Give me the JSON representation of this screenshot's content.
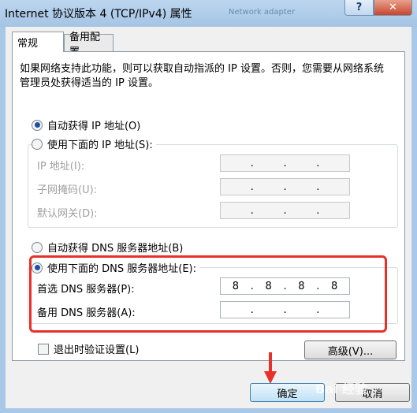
{
  "window": {
    "title": "Internet 协议版本 4 (TCP/IPv4) 属性",
    "background_title": "Network adapter",
    "help_label": "?",
    "close_label": "✕"
  },
  "tabs": [
    {
      "label": "常规",
      "active": true
    },
    {
      "label": "备用配置",
      "active": false
    }
  ],
  "intro_text": "如果网络支持此功能，则可以获取自动指派的 IP 设置。否则，您需要从网络系统管理员处获得适当的 IP 设置。",
  "ip_section": {
    "auto_label": "自动获得 IP 地址(O)",
    "manual_label": "使用下面的 IP 地址(S):",
    "fields": [
      {
        "label": "IP 地址(I):",
        "value": [
          "",
          "",
          "",
          ""
        ]
      },
      {
        "label": "子网掩码(U):",
        "value": [
          "",
          "",
          "",
          ""
        ]
      },
      {
        "label": "默认网关(D):",
        "value": [
          "",
          "",
          "",
          ""
        ]
      }
    ],
    "selected": "auto"
  },
  "dns_section": {
    "auto_label": "自动获得 DNS 服务器地址(B)",
    "manual_label": "使用下面的 DNS 服务器地址(E):",
    "selected": "manual",
    "fields": [
      {
        "label": "首选 DNS 服务器(P):",
        "value": [
          "8",
          "8",
          "8",
          "8"
        ]
      },
      {
        "label": "备用 DNS 服务器(A):",
        "value": [
          "",
          "",
          "",
          ""
        ]
      }
    ]
  },
  "validate_label": "退出时验证设置(L)",
  "advanced_label": "高级(V)...",
  "ok_label": "确定",
  "cancel_label": "取消",
  "watermark": "Bai 经验",
  "colors": {
    "highlight": "#e8302a",
    "radio_selected": "#1a50a8"
  }
}
